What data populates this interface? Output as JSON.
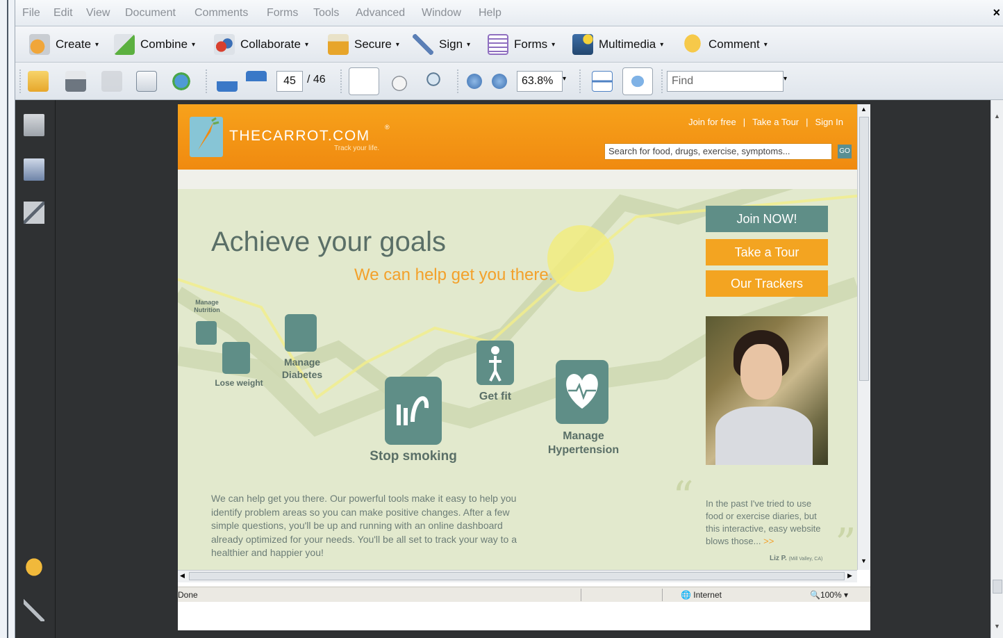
{
  "menu": [
    "File",
    "Edit",
    "View",
    "Document",
    "Comments",
    "Forms",
    "Tools",
    "Advanced",
    "Window",
    "Help"
  ],
  "menu_close": "×",
  "toolbar": [
    {
      "label": "Create",
      "icon": "create-pdf-icon"
    },
    {
      "label": "Combine",
      "icon": "combine-icon"
    },
    {
      "label": "Collaborate",
      "icon": "collaborate-icon"
    },
    {
      "label": "Secure",
      "icon": "lock-icon"
    },
    {
      "label": "Sign",
      "icon": "pen-icon"
    },
    {
      "label": "Forms",
      "icon": "forms-icon"
    },
    {
      "label": "Multimedia",
      "icon": "multimedia-icon"
    },
    {
      "label": "Comment",
      "icon": "comment-icon"
    }
  ],
  "caret": "▾",
  "nav": {
    "page_current": "45",
    "page_total": "/ 46",
    "zoom": "63.8%",
    "find_placeholder": "Find"
  },
  "colors": {
    "orange": "#f08a10",
    "teal": "#5f8e87",
    "hero_bg": "#e2e9cd",
    "viewer_bg": "#2f3133"
  },
  "site": {
    "brand": "THECARROT.COM",
    "registered": "®",
    "tagline": "Track your life.",
    "header_links": [
      "Join for free",
      "|",
      "Take a Tour",
      "|",
      "Sign In"
    ],
    "search_placeholder": "Search for food, drugs, exercise, symptoms...",
    "search_go": "GO",
    "headline": "Achieve your goals",
    "subheadline": "We can help get you there.",
    "buttons": [
      "Join NOW!",
      "Take a Tour",
      "Our Trackers"
    ],
    "goals": [
      "Manage Nutrition",
      "Lose weight",
      "Manage Diabetes",
      "Stop smoking",
      "Get fit",
      "Manage Hypertension"
    ],
    "body": "We can help get you there. Our powerful tools make it easy to help you identify problem areas so you can make positive changes. After a few simple questions, you'll be up and running with an online dashboard already optimized for your needs. You'll be all set to track your way to a healthier and happier you!",
    "quote": "In the past I've tried to use food or exercise diaries, but this interactive, easy website blows those...",
    "quote_more": ">>",
    "quote_author": "Liz P.",
    "quote_location": "(Mill Valley, CA)"
  },
  "browser_status": {
    "left": "Done",
    "zone": "Internet",
    "zoom": "100%"
  }
}
